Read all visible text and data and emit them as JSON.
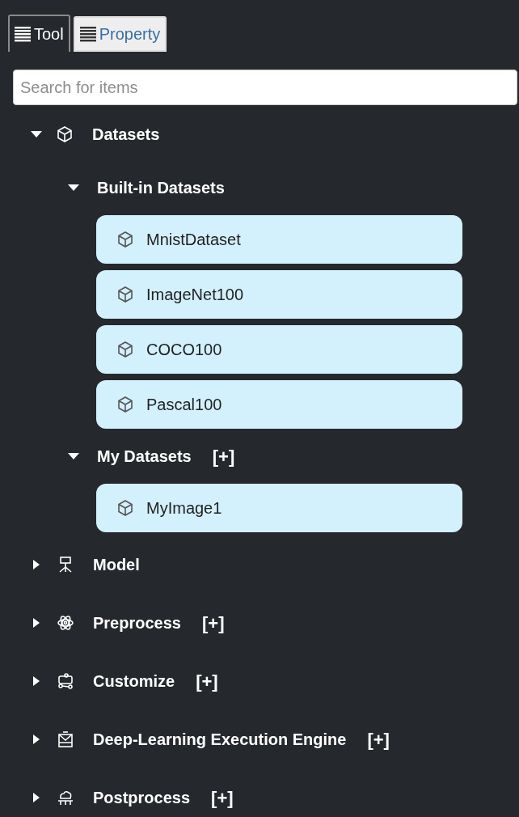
{
  "tabs": [
    {
      "label": "Tool",
      "selected": true
    },
    {
      "label": "Property",
      "selected": false
    }
  ],
  "search": {
    "placeholder": "Search for items"
  },
  "tree": [
    {
      "label": "Datasets",
      "expanded": true,
      "children": [
        {
          "kind": "group",
          "label": "Built-in Datasets",
          "expanded": true,
          "children": [
            {
              "kind": "item",
              "label": "MnistDataset"
            },
            {
              "kind": "item",
              "label": "ImageNet100"
            },
            {
              "kind": "item",
              "label": "COCO100"
            },
            {
              "kind": "item",
              "label": "Pascal100"
            }
          ]
        },
        {
          "kind": "group",
          "label": "My Datasets",
          "add": "[+]",
          "expanded": true,
          "children": [
            {
              "kind": "item",
              "label": "MyImage1"
            }
          ]
        }
      ]
    },
    {
      "label": "Model",
      "expanded": false
    },
    {
      "label": "Preprocess",
      "add": "[+]",
      "expanded": false
    },
    {
      "label": "Customize",
      "add": "[+]",
      "expanded": false
    },
    {
      "label": "Deep-Learning Execution Engine",
      "add": "[+]",
      "expanded": false
    },
    {
      "label": "Postprocess",
      "add": "[+]",
      "expanded": false
    }
  ]
}
